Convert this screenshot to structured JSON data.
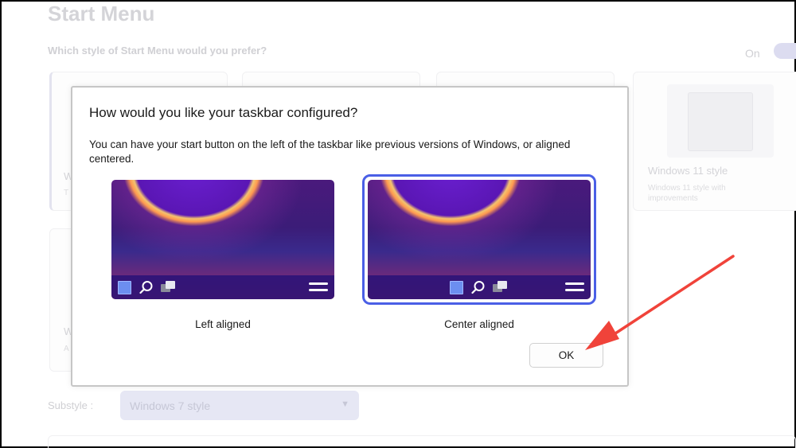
{
  "background": {
    "page_title": "Start Menu",
    "question": "Which style of Start Menu would you prefer?",
    "toggle_label": "On",
    "card_w11_title": "Windows 11 style",
    "card_w11_sub": "Windows 11 style with improvements",
    "card_left_title_fragment": "W",
    "card_left_sub_fragment": "T",
    "card_left2_title_fragment": "W",
    "card_left2_sub_fragment": "A",
    "substyle_label": "Substyle :",
    "substyle_value": "Windows 7 style"
  },
  "dialog": {
    "title": "How would you like your taskbar configured?",
    "description": "You can have your start button on the left of the taskbar like previous versions of Windows, or aligned centered.",
    "options": [
      {
        "label": "Left aligned",
        "selected": false
      },
      {
        "label": "Center aligned",
        "selected": true
      }
    ],
    "ok_label": "OK"
  },
  "colors": {
    "selection_ring": "#4a5fe6",
    "annotation_arrow": "#f0433a"
  },
  "icons": [
    "start-icon",
    "search-icon",
    "task-view-icon",
    "menu-icon",
    "chevron-down-icon"
  ]
}
